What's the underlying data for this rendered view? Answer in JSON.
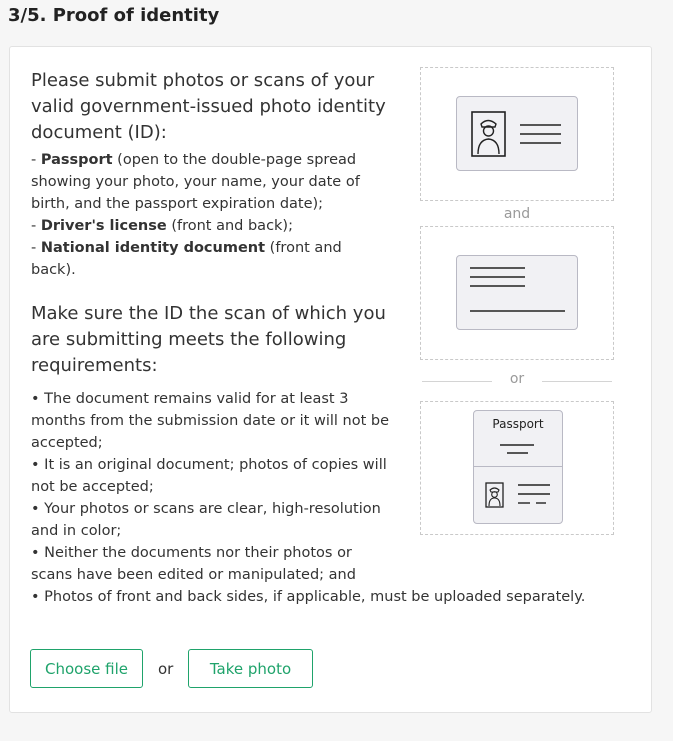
{
  "header": {
    "title": "3/5. Proof of identity"
  },
  "intro": "Please submit photos or scans of your valid government-issued photo identity document (ID):",
  "documents": [
    {
      "name": "Passport",
      "note": " (open to the double-page spread showing your photo, your name, your date of birth, and the passport expiration date);"
    },
    {
      "name": "Driver's license",
      "note": " (front and back);"
    },
    {
      "name": "National identity document",
      "note": " (front and back)."
    }
  ],
  "requirements_intro": "Make sure the ID the scan of which you are submitting meets the following requirements:",
  "requirements": [
    "• The document remains valid for at least 3 months from the submission date or it will not be accepted;",
    "• It is an original document; photos of copies will not be accepted;",
    "• Your photos or scans are clear, high-resolution and in color;",
    "• Neither the documents nor their photos or scans have been edited or manipulated; and",
    "• Photos of front and back sides, if applicable, must be uploaded separately."
  ],
  "illustrations": {
    "and_label": "and",
    "or_label": "or",
    "passport_label": "Passport"
  },
  "actions": {
    "choose_file": "Choose file",
    "or_label": "or",
    "take_photo": "Take photo"
  },
  "colors": {
    "accent": "#1fa36b",
    "card_border": "#e2e2e2",
    "illustration_fill": "#f1f1f4"
  }
}
